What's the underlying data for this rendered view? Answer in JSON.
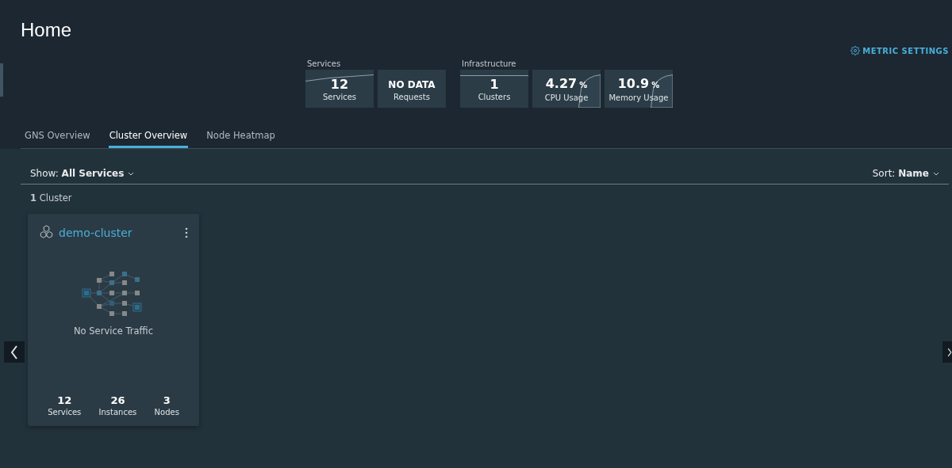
{
  "page": {
    "title": "Home"
  },
  "metric_settings": {
    "label": "METRIC SETTINGS"
  },
  "metric_groups": [
    {
      "title": "Services",
      "tiles": [
        {
          "value": "12",
          "label": "Services",
          "kind": "rising"
        },
        {
          "value": "NO DATA",
          "label": "Requests",
          "kind": "plain"
        }
      ]
    },
    {
      "title": "Infrastructure",
      "tiles": [
        {
          "value": "1",
          "label": "Clusters",
          "kind": "flat"
        },
        {
          "value": "4.27",
          "unit": "%",
          "label": "CPU Usage",
          "kind": "spike"
        },
        {
          "value": "10.9",
          "unit": "%",
          "label": "Memory Usage",
          "kind": "spike"
        }
      ]
    }
  ],
  "tabs": [
    {
      "label": "GNS Overview",
      "selected": false
    },
    {
      "label": "Cluster Overview",
      "selected": true
    },
    {
      "label": "Node Heatmap",
      "selected": false
    }
  ],
  "filter": {
    "show": "Show: **All Services**",
    "sort": "Sort: **Name**"
  },
  "count": "**1** Cluster",
  "clusters": [
    {
      "name": "demo-cluster",
      "empty_text": "No Service Traffic",
      "stats": [
        {
          "value": "12",
          "label": "Services"
        },
        {
          "value": "26",
          "label": "Instances"
        },
        {
          "value": "3",
          "label": "Nodes"
        }
      ]
    }
  ]
}
